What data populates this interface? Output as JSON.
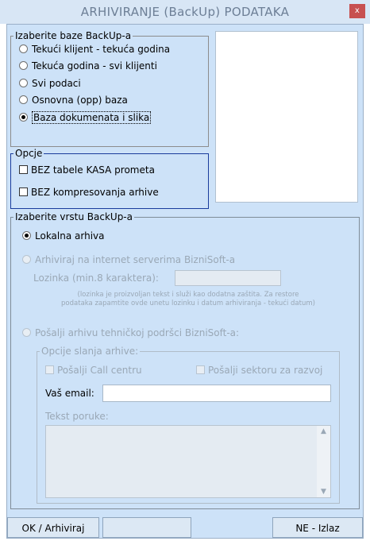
{
  "window": {
    "title": "ARHIVIRANJE (BackUp)  PODATAKA",
    "close_glyph": "x"
  },
  "backup_bases": {
    "legend": "Izaberite baze BackUp-a",
    "options": [
      {
        "label": "Tekući klijent - tekuća godina",
        "selected": false
      },
      {
        "label": "Tekuća godina - svi klijenti",
        "selected": false
      },
      {
        "label": "Svi podaci",
        "selected": false
      },
      {
        "label": "Osnovna (opp) baza",
        "selected": false
      },
      {
        "label": "Baza dokumenata i slika",
        "selected": true
      }
    ]
  },
  "options": {
    "legend": "Opcje",
    "items": [
      {
        "label": "BEZ tabele KASA prometa",
        "checked": false
      },
      {
        "label": "BEZ kompresovanja arhive",
        "checked": false
      }
    ]
  },
  "backup_type": {
    "legend": "Izaberite vrstu BackUp-a",
    "local": {
      "label": "Lokalna arhiva",
      "selected": true
    },
    "internet": {
      "label": "Arhiviraj na internet serverima BizniSoft-a",
      "selected": false
    },
    "password_label": "Lozinka (min.8 karaktera):",
    "password_value": "",
    "note_line1": "(lozinka je proizvoljan tekst i služi kao dodatna zaštita. Za restore",
    "note_line2": "podataka zapamtite ovde unetu lozinku i datum arhiviranja - tekući datum)",
    "support": {
      "label": "Pošalji arhivu tehničkoj podršci BizniSoft-a:",
      "selected": false
    },
    "send_options": {
      "legend": "Opcije slanja arhive:",
      "call_center": "Pošalji Call centru",
      "dev_sector": "Pošalji sektoru za razvoj",
      "email_label": "Vaš email:",
      "email_value": "",
      "message_label": "Tekst poruke:",
      "message_value": ""
    }
  },
  "footer": {
    "ok_label": "OK / Arhiviraj",
    "exit_label": "NE - Izlaz"
  },
  "colors": {
    "client_bg": "#cde2f8",
    "group_border": "#1a3c9c",
    "disabled_text": "#9aa8b6",
    "close_bg": "#c75050"
  }
}
